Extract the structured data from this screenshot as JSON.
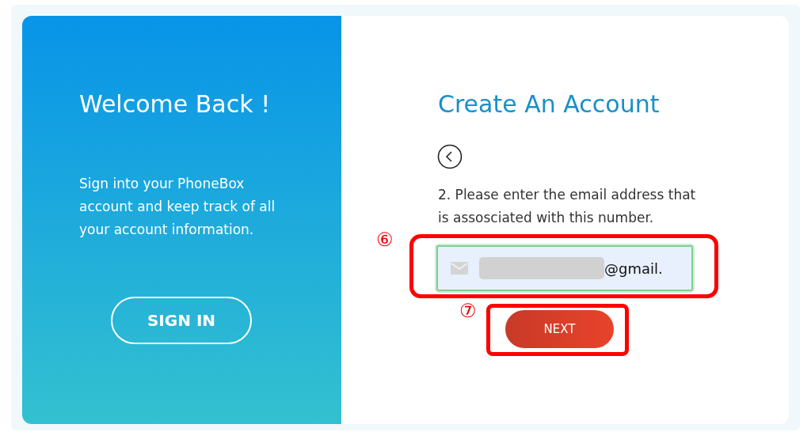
{
  "left_panel": {
    "title": "Welcome Back !",
    "text": "Sign into your PhoneBox account and keep track of all your account information.",
    "button": "SIGN IN"
  },
  "right_panel": {
    "title": "Create An Account",
    "instruction": "2. Please enter the email address that is assosciated with this number.",
    "email_field": {
      "value": "@gmail.",
      "redacted": true,
      "valid": true
    },
    "next_button": "NEXT"
  },
  "annotations": [
    {
      "label": "⑥"
    },
    {
      "label": "⑦"
    }
  ]
}
